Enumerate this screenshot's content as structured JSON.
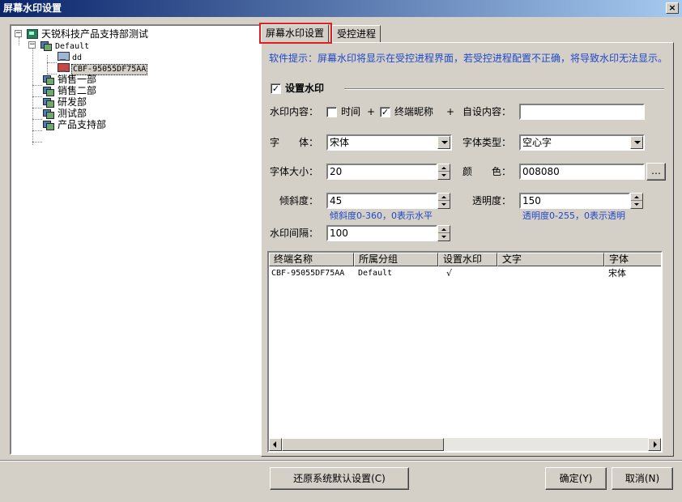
{
  "window": {
    "title": "屏幕水印设置",
    "close_label": "×"
  },
  "tree": {
    "root": "天锐科技产品支持部测试",
    "default_group": "Default",
    "default_children": [
      "dd",
      "CBF-95055DF75AA"
    ],
    "groups": [
      "销售一部",
      "销售二部",
      "研发部",
      "测试部",
      "产品支持部"
    ],
    "expander_minus": "−"
  },
  "tabs": [
    {
      "label": "屏幕水印设置",
      "active": true
    },
    {
      "label": "受控进程",
      "active": false
    }
  ],
  "settings": {
    "hint": "软件提示：屏幕水印将显示在受控进程界面，若受控进程配置不正确，将导致水印无法显示。",
    "enable_label": "设置水印",
    "enable_checked": "✓",
    "content_label": "水印内容：",
    "time_label": "时间",
    "time_checked": "",
    "plus1": "+",
    "nickname_label": "终端昵称",
    "nickname_checked": "✓",
    "plus2": "+",
    "custom_label": "自设内容：",
    "custom_value": "",
    "font_label": "字　　体：",
    "font_value": "宋体",
    "font_type_label": "字体类型：",
    "font_type_value": "空心字",
    "size_label": "字体大小：",
    "size_value": "20",
    "color_label": "颜　　色：",
    "color_value": "008080",
    "color_button": "…",
    "tilt_label": "倾斜度：",
    "tilt_value": "45",
    "tilt_hint": "倾斜度0-360，0表示水平",
    "opacity_label": "透明度：",
    "opacity_value": "150",
    "opacity_hint": "透明度0-255，0表示透明",
    "spacing_label": "水印间隔：",
    "spacing_value": "100"
  },
  "table": {
    "columns": [
      "终端名称",
      "所属分组",
      "设置水印",
      "文字",
      "字体"
    ],
    "rows": [
      [
        "CBF-95055DF75AA",
        "Default",
        "√",
        "",
        "宋体"
      ]
    ]
  },
  "footer": {
    "restore_label": "还原系统默认设置(C)",
    "ok_label": "确定(Y)",
    "cancel_label": "取消(N)"
  }
}
